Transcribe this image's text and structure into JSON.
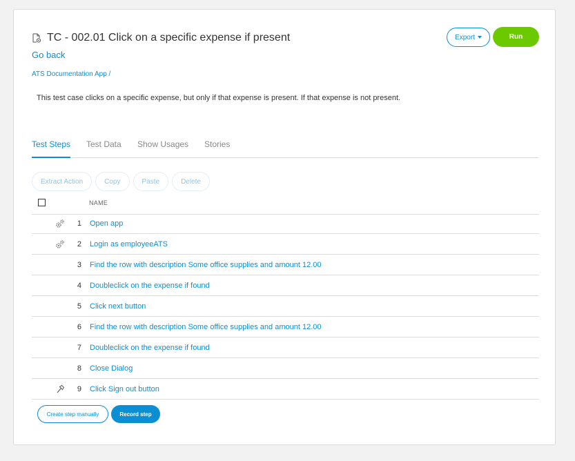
{
  "header": {
    "title": "TC - 002.01 Click on a specific expense if present",
    "go_back": "Go back",
    "breadcrumb": "ATS Documentation App /",
    "description": "This test case clicks on a specific expense, but only if that expense is present. If that expense is not present.",
    "export_label": "Export",
    "run_label": "Run"
  },
  "tabs": [
    {
      "label": "Test Steps",
      "active": true
    },
    {
      "label": "Test Data",
      "active": false
    },
    {
      "label": "Show Usages",
      "active": false
    },
    {
      "label": "Stories",
      "active": false
    }
  ],
  "toolbar": {
    "extract_action": "Extract Action",
    "copy": "Copy",
    "paste": "Paste",
    "delete": "Delete"
  },
  "table": {
    "column_name": "NAME",
    "rows": [
      {
        "num": "1",
        "label": "Open app",
        "icon": "gears-icon"
      },
      {
        "num": "2",
        "label": "Login as employeeATS",
        "icon": "gears-icon"
      },
      {
        "num": "3",
        "label": "Find the row with description Some office supplies and amount 12.00",
        "icon": ""
      },
      {
        "num": "4",
        "label": "Doubleclick on the expense if found",
        "icon": ""
      },
      {
        "num": "5",
        "label": "Click next button",
        "icon": ""
      },
      {
        "num": "6",
        "label": "Find the row with description Some office supplies and amount 12.00",
        "icon": ""
      },
      {
        "num": "7",
        "label": "Doubleclick on the expense if found",
        "icon": ""
      },
      {
        "num": "8",
        "label": "Close Dialog",
        "icon": ""
      },
      {
        "num": "9",
        "label": "Click Sign out button",
        "icon": "hammer-icon"
      }
    ]
  },
  "footer": {
    "create_step": "Create step manually",
    "record_step": "Record step"
  },
  "colors": {
    "accent": "#0a8fd2",
    "run": "#6cc900"
  }
}
